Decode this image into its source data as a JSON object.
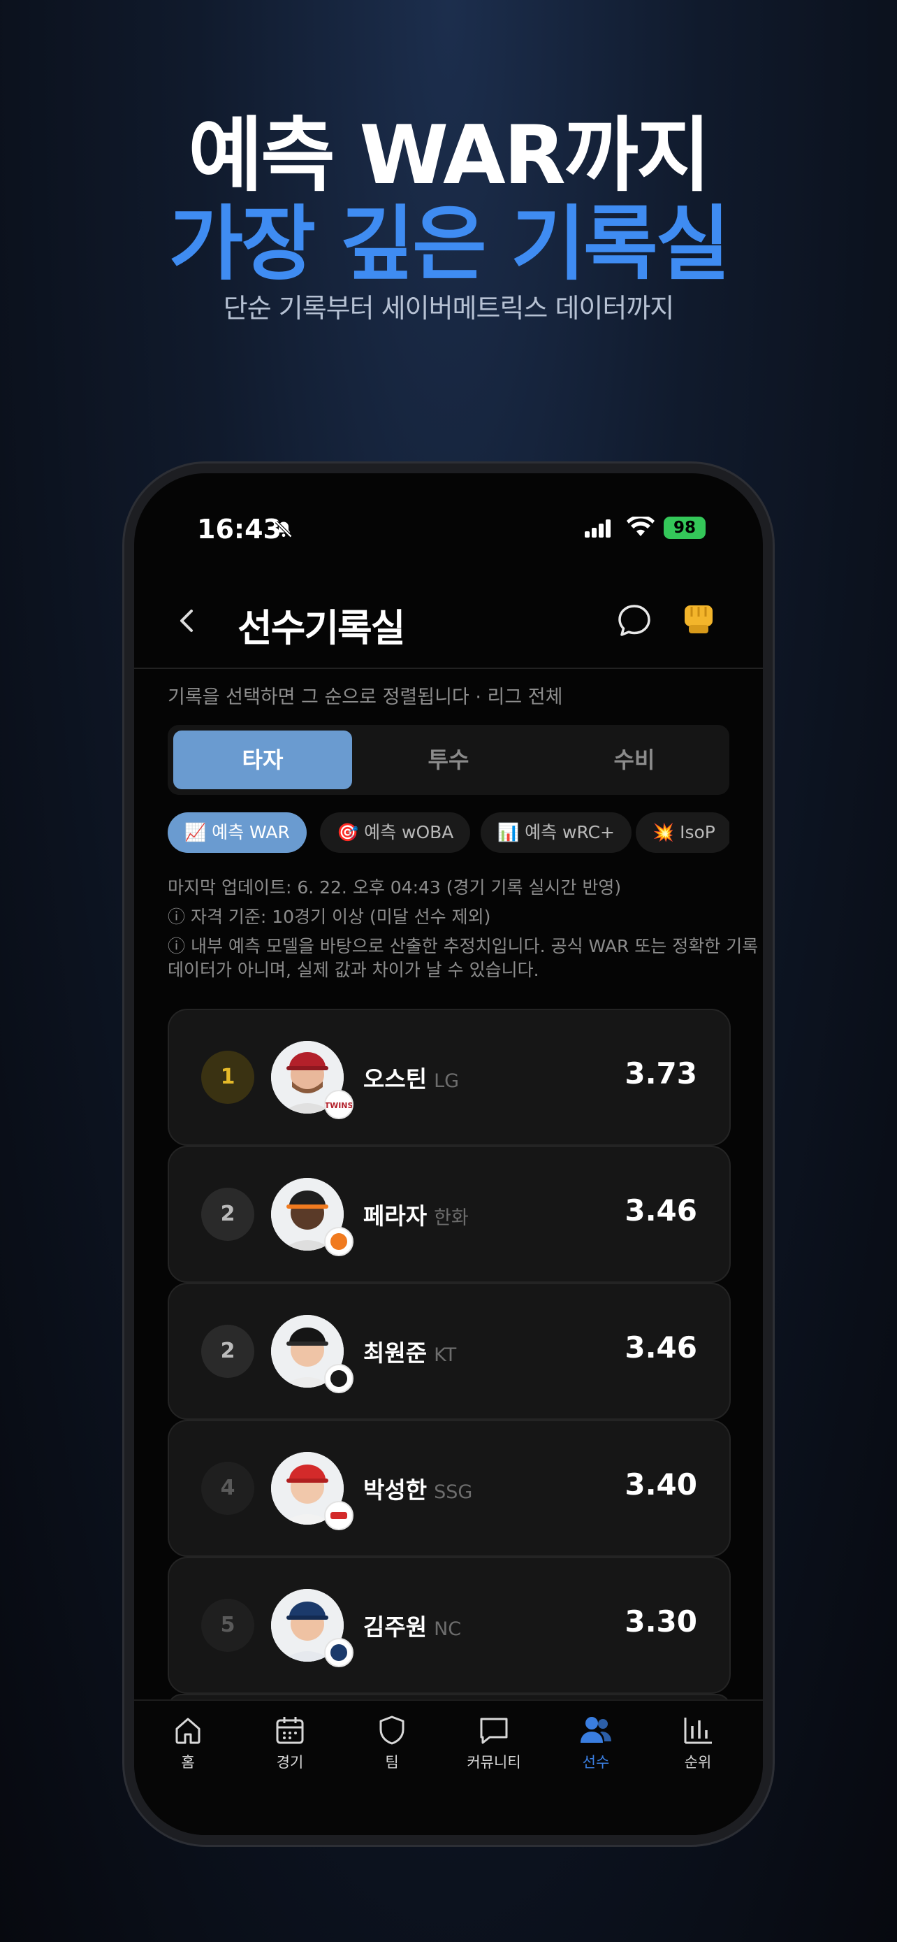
{
  "promo": {
    "title_line1": "예측 WAR까지",
    "title_line2": "가장 깊은 기록실",
    "subtitle": "단순 기록부터 세이버메트릭스 데이터까지"
  },
  "status_bar": {
    "time": "16:43",
    "battery": "98"
  },
  "header": {
    "title": "선수기록실"
  },
  "hint": "기록을 선택하면 그 순으로 정렬됩니다 · 리그 전체",
  "tabs": [
    {
      "label": "타자",
      "active": true
    },
    {
      "label": "투수",
      "active": false
    },
    {
      "label": "수비",
      "active": false
    }
  ],
  "chips": [
    {
      "label": "📈 예측 WAR",
      "active": true
    },
    {
      "label": "🎯 예측 wOBA",
      "active": false
    },
    {
      "label": "📊 예측 wRC+",
      "active": false
    },
    {
      "label": "💥 IsoP",
      "active": false
    }
  ],
  "info": {
    "last_update": "마지막 업데이트: 6. 22. 오후 04:43 (경기 기록 실시간 반영)",
    "qualification": "ⓘ 자격 기준: 10경기 이상 (미달 선수 제외)",
    "disclaimer_line1": "ⓘ 내부 예측 모델을 바탕으로 산출한 추정치입니다. 공식 WAR 또는 정확한 기록",
    "disclaimer_line2": "데이터가 아니며, 실제 값과 차이가 날 수 있습니다."
  },
  "players": [
    {
      "rank": "1",
      "name": "오스틴",
      "team": "LG",
      "value": "3.73",
      "cap_color": "#b3202a"
    },
    {
      "rank": "2",
      "name": "페라자",
      "team": "한화",
      "value": "3.46",
      "cap_color": "#1f1f1f"
    },
    {
      "rank": "2",
      "name": "최원준",
      "team": "KT",
      "value": "3.46",
      "cap_color": "#151515"
    },
    {
      "rank": "4",
      "name": "박성한",
      "team": "SSG",
      "value": "3.40",
      "cap_color": "#d32a2a"
    },
    {
      "rank": "5",
      "name": "김주원",
      "team": "NC",
      "value": "3.30",
      "cap_color": "#1b3a6b"
    }
  ],
  "nav": [
    {
      "label": "홈",
      "icon": "home-icon"
    },
    {
      "label": "경기",
      "icon": "calendar-icon"
    },
    {
      "label": "팀",
      "icon": "shield-icon"
    },
    {
      "label": "커뮤니티",
      "icon": "chat-icon"
    },
    {
      "label": "선수",
      "icon": "users-icon",
      "active": true
    },
    {
      "label": "순위",
      "icon": "chart-icon"
    }
  ],
  "colors": {
    "accent": "#3f8cf2",
    "tab_active": "#6a9bd0",
    "rank_gold": "#e4b929"
  }
}
